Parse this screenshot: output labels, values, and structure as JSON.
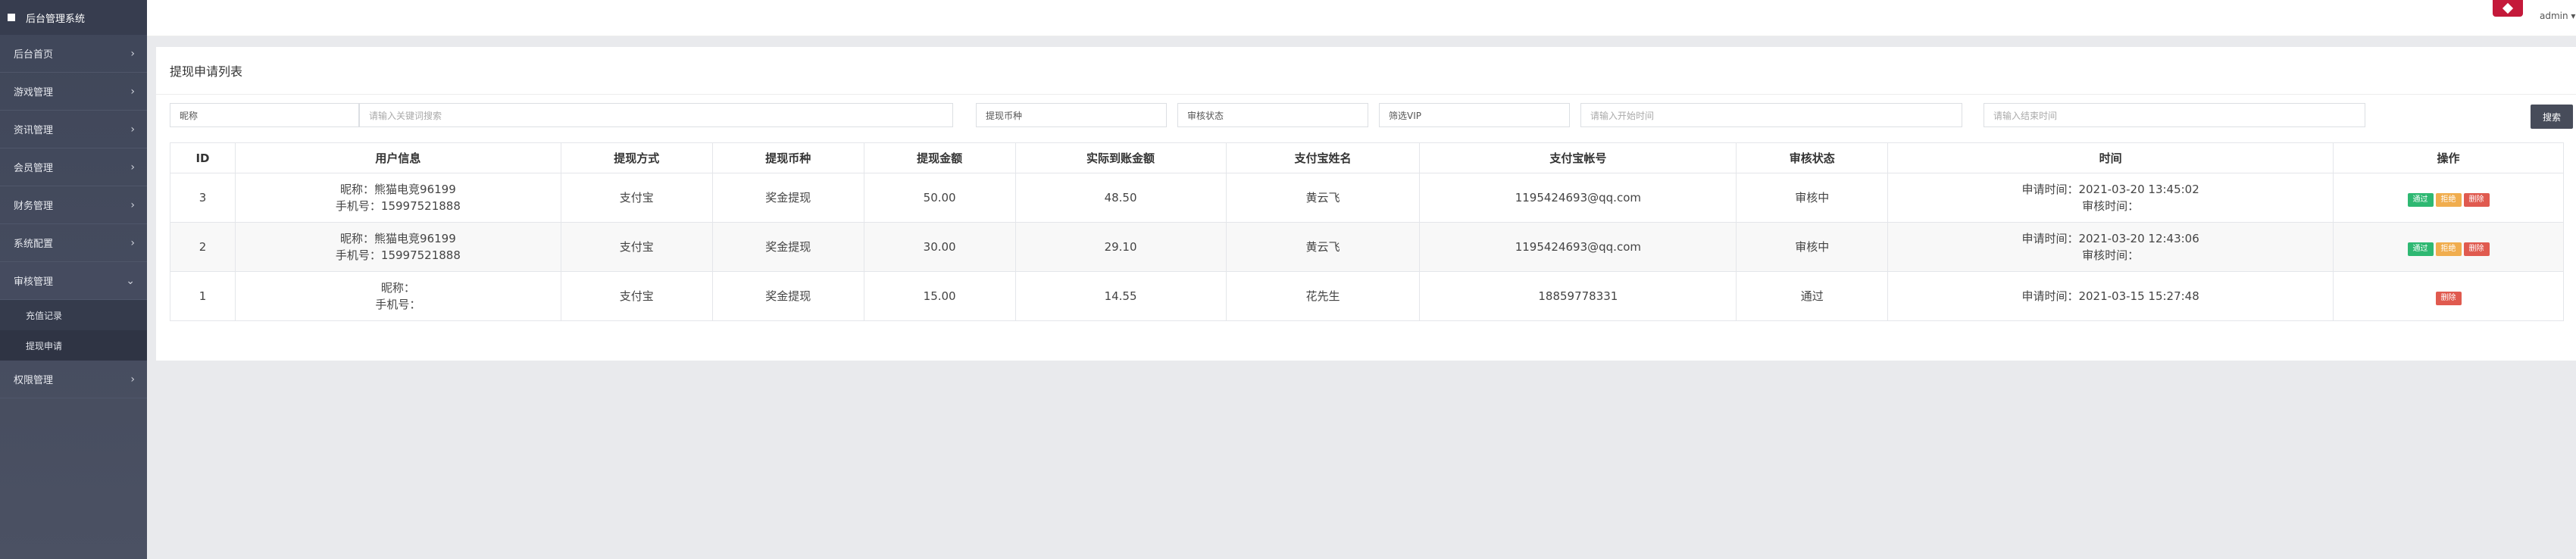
{
  "sidebar": {
    "brand": "后台管理系统",
    "items": [
      {
        "label": "后台首页"
      },
      {
        "label": "游戏管理"
      },
      {
        "label": "资讯管理"
      },
      {
        "label": "会员管理"
      },
      {
        "label": "财务管理"
      },
      {
        "label": "系统配置"
      },
      {
        "label": "审核管理"
      },
      {
        "label": "权限管理"
      }
    ],
    "sub_items": [
      {
        "label": "充值记录"
      },
      {
        "label": "提现申请"
      }
    ]
  },
  "topbar": {
    "user": "admin ▾"
  },
  "page": {
    "title": "提现申请列表"
  },
  "filters": {
    "nickname_label": "昵称",
    "keyword_placeholder": "请输入关键词搜索",
    "currency": "提现币种",
    "status": "审核状态",
    "vip": "筛选VIP",
    "start_placeholder": "请输入开始时间",
    "end_placeholder": "请输入结束时间",
    "search": "搜索"
  },
  "table": {
    "headers": [
      "ID",
      "用户信息",
      "提现方式",
      "提现币种",
      "提现金额",
      "实际到账金额",
      "支付宝姓名",
      "支付宝帐号",
      "审核状态",
      "时间",
      "操作"
    ],
    "rows": [
      {
        "id": "3",
        "nick": "昵称：熊猫电竞96199",
        "phone": "手机号：15997521888",
        "method": "支付宝",
        "currency": "奖金提现",
        "amount": "50.00",
        "actual": "48.50",
        "name": "黄云飞",
        "account": "1195424693@qq.com",
        "status": "审核中",
        "time1": "申请时间：2021-03-20 13:45:02",
        "time2": "审核时间：",
        "b_pass": "通过",
        "b_reject": "拒绝",
        "b_del": "删除"
      },
      {
        "id": "2",
        "nick": "昵称：熊猫电竞96199",
        "phone": "手机号：15997521888",
        "method": "支付宝",
        "currency": "奖金提现",
        "amount": "30.00",
        "actual": "29.10",
        "name": "黄云飞",
        "account": "1195424693@qq.com",
        "status": "审核中",
        "time1": "申请时间：2021-03-20 12:43:06",
        "time2": "审核时间：",
        "b_pass": "通过",
        "b_reject": "拒绝",
        "b_del": "删除"
      },
      {
        "id": "1",
        "nick": "昵称：",
        "phone": "手机号：",
        "method": "支付宝",
        "currency": "奖金提现",
        "amount": "15.00",
        "actual": "14.55",
        "name": "花先生",
        "account": "18859778331",
        "status": "通过",
        "time1": "申请时间：2021-03-15 15:27:48",
        "b_del": "删除"
      }
    ]
  }
}
